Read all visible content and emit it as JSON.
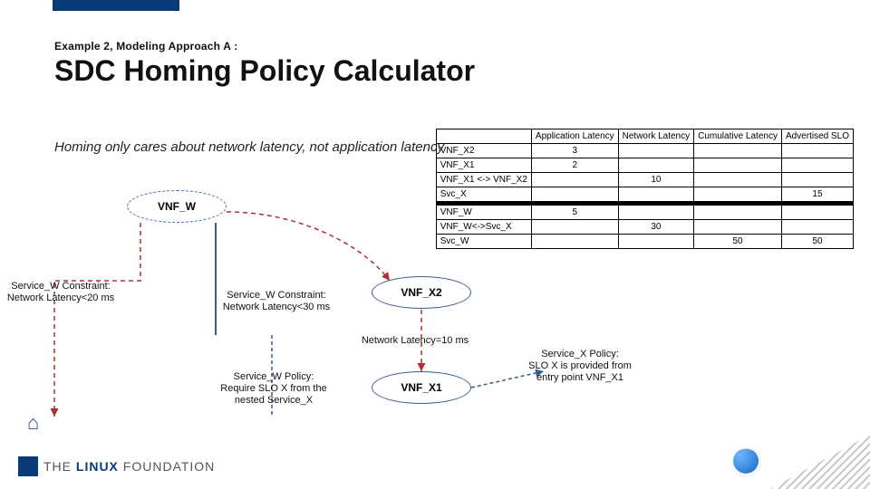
{
  "header": {
    "eyebrow": "Example 2, Modeling Approach A :",
    "title": "SDC Homing Policy Calculator"
  },
  "subtitle": "Homing only cares about network latency, not application latency",
  "table": {
    "headers": [
      "",
      "Application Latency",
      "Network Latency",
      "Cumulative Latency",
      "Advertised SLO"
    ],
    "group1": [
      {
        "label": "VNF_X2",
        "app": "3",
        "net": "",
        "cum": "",
        "slo": ""
      },
      {
        "label": "VNF_X1",
        "app": "2",
        "net": "",
        "cum": "",
        "slo": ""
      },
      {
        "label": "VNF_X1 <-> VNF_X2",
        "app": "",
        "net": "10",
        "cum": "",
        "slo": ""
      },
      {
        "label": "Svc_X",
        "app": "",
        "net": "",
        "cum": "",
        "slo": "15"
      }
    ],
    "group2": [
      {
        "label": "VNF_W",
        "app": "5",
        "net": "",
        "cum": "",
        "slo": ""
      },
      {
        "label": "VNF_W<->Svc_X",
        "app": "",
        "net": "30",
        "cum": "",
        "slo": ""
      },
      {
        "label": "Svc_W",
        "app": "",
        "net": "",
        "cum": "50",
        "slo": "50"
      }
    ]
  },
  "nodes": {
    "vnf_w": "VNF_W",
    "vnf_x2": "VNF_X2",
    "vnf_x1": "VNF_X1"
  },
  "annotations": {
    "constraint_w_20": "Service_W Constraint:\nNetwork Latency<20 ms",
    "constraint_w_30": "Service_W Constraint:\nNetwork Latency<30 ms",
    "link_latency": "Network Latency=10 ms",
    "policy_w": "Service_W Policy:\nRequire SLO X from the\nnested Service_X",
    "policy_x": "Service_X Policy:\nSLO X is provided from\nentry point VNF_X1"
  },
  "footer": {
    "linux": "THE LINUX FOUNDATION"
  }
}
